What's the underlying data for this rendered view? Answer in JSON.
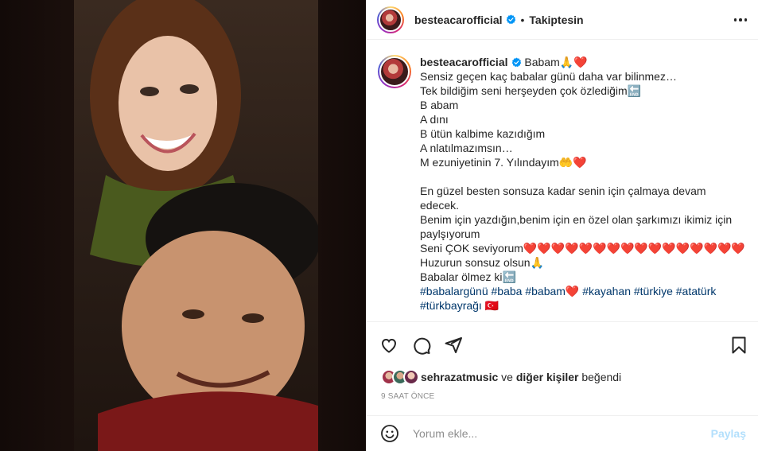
{
  "post": {
    "username": "besteacarofficial",
    "follow_label": "Takiptesin",
    "separator": "•"
  },
  "caption": {
    "username": "besteacarofficial",
    "lines": [
      "Babam🙏❤️",
      "Sensiz geçen kaç babalar günü daha var bilinmez…",
      "Tek bildiğim seni herşeyden çok özlediğim🔚",
      "B abam",
      "A dını",
      "B ütün kalbime kazıdığım",
      "A nlatılmazımsın…",
      "M ezuniyetinin 7. Yılındayım🤲❤️",
      "",
      "En güzel besten sonsuza kadar senin için çalmaya devam edecek.",
      "Benim için yazdığın,benim için en özel olan şarkımızı ikimiz için paylşıyorum",
      "Seni ÇOK seviyorum❤️❤️❤️❤️❤️❤️❤️❤️❤️❤️❤️❤️❤️❤️❤️❤️",
      "Huzurun sonsuz olsun🙏",
      "Babalar ölmez ki🔚"
    ],
    "hashtags": "#babalargünü #baba #babam❤️ #kayahan #türkiye #atatürk",
    "hashtags_cut": "#türkbayrağı 🇹🇷"
  },
  "likes": {
    "user": "sehrazatmusic",
    "connector": " ve ",
    "others": "diğer kişiler",
    "suffix": " beğendi"
  },
  "timestamp": "9 SAAT ÖNCE",
  "comment": {
    "placeholder": "Yorum ekle...",
    "post_label": "Paylaş"
  },
  "icons": {
    "verified": "verified-badge-icon",
    "like": "heart-icon",
    "comment": "comment-bubble-icon",
    "share": "paper-plane-icon",
    "save": "bookmark-icon",
    "emoji": "smiley-icon",
    "more": "more-options-icon"
  },
  "colors": {
    "verified": "#0095f6",
    "hashtag": "#00376b",
    "post_disabled": "#b2dffc",
    "muted": "#8e8e8e"
  }
}
